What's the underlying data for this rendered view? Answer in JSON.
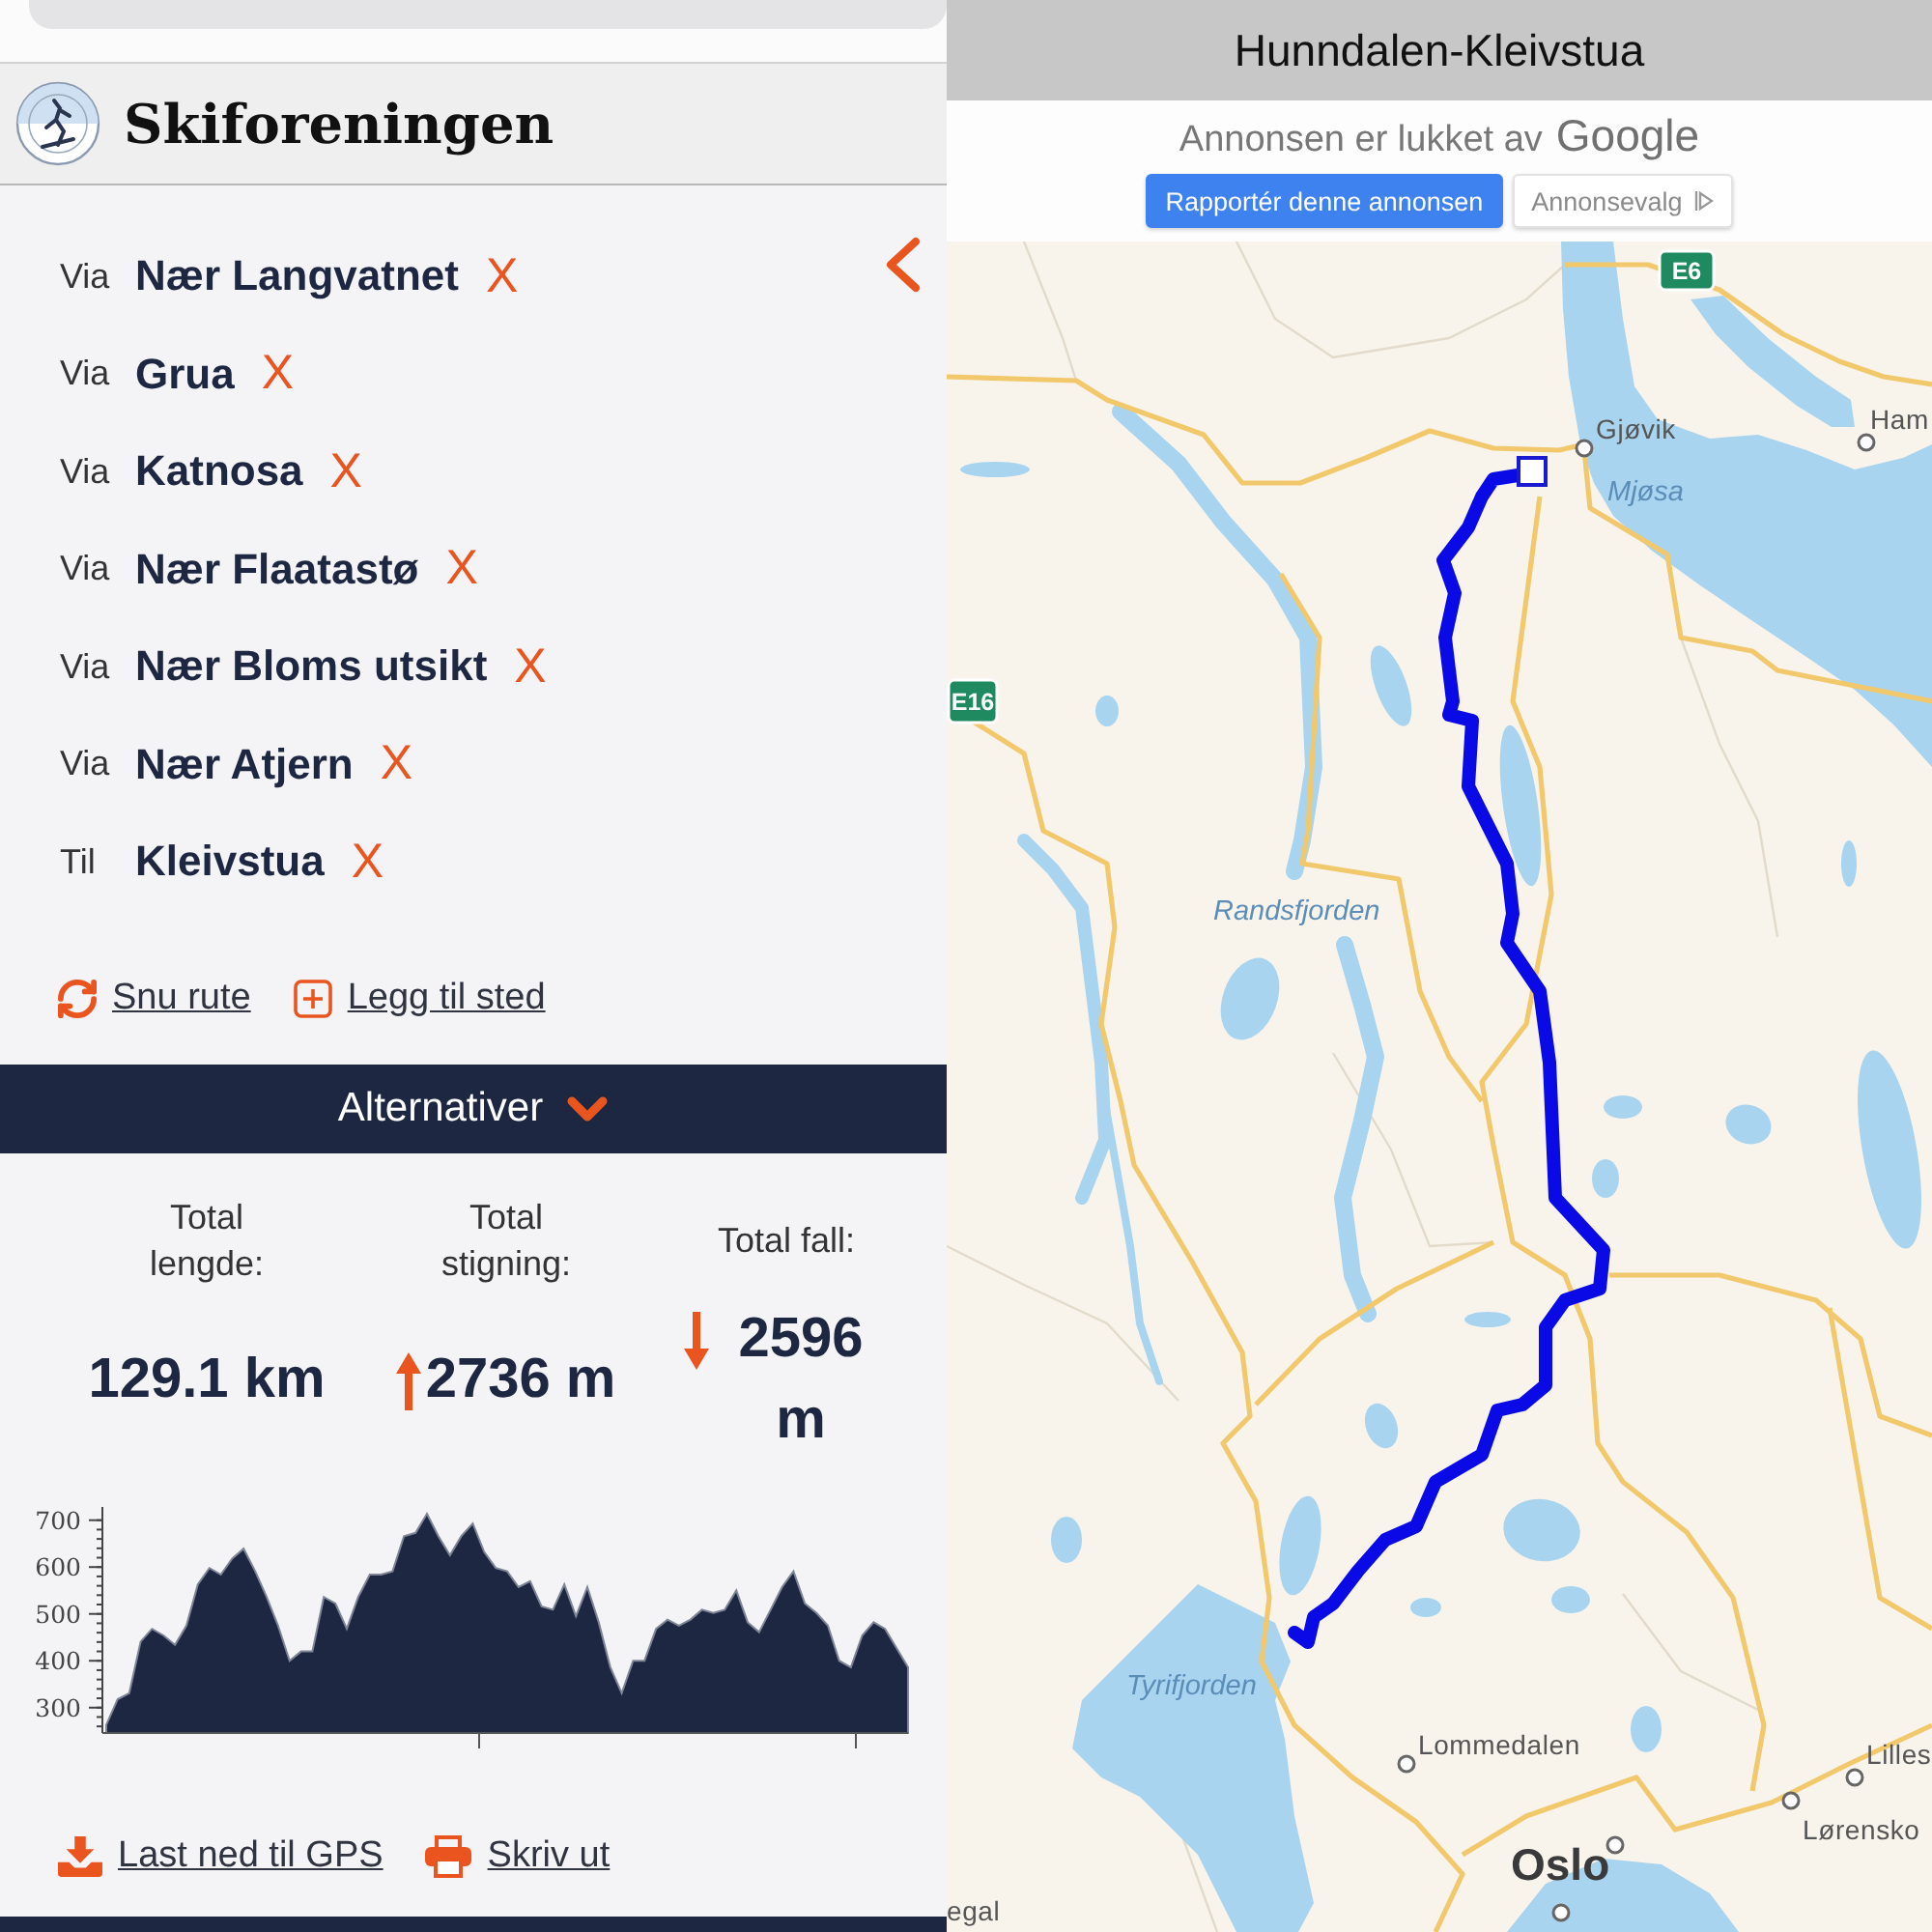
{
  "header": {
    "title": "Skiforeningen"
  },
  "route": {
    "stops": [
      {
        "prefix": "Via",
        "name": "Nær Langvatnet",
        "remove": "X"
      },
      {
        "prefix": "Via",
        "name": "Grua",
        "remove": "X"
      },
      {
        "prefix": "Via",
        "name": "Katnosa",
        "remove": "X"
      },
      {
        "prefix": "Via",
        "name": "Nær Flaatastø",
        "remove": "X"
      },
      {
        "prefix": "Via",
        "name": "Nær Bloms utsikt",
        "remove": "X"
      },
      {
        "prefix": "Via",
        "name": "Nær Atjern",
        "remove": "X"
      },
      {
        "prefix": "Til",
        "name": "Kleivstua",
        "remove": "X"
      }
    ]
  },
  "route_actions": [
    {
      "kind": "reverse",
      "label": "Snu rute"
    },
    {
      "kind": "add",
      "label": "Legg til sted"
    }
  ],
  "options_bar": {
    "label": "Alternativer",
    "expanded": false
  },
  "stats": [
    {
      "kind": "distance",
      "label": "Total lengde:",
      "value": "129.1 km"
    },
    {
      "kind": "ascent",
      "label": "Total stigning:",
      "value": "2736 m"
    },
    {
      "kind": "descent",
      "label": "Total fall:",
      "value": "2596 m"
    }
  ],
  "elevation_profile": {
    "chart_data": {
      "type": "area",
      "ylim": [
        250,
        720
      ],
      "yticks": [
        300,
        400,
        500,
        600,
        700
      ],
      "values": [
        263,
        318,
        331,
        441,
        468,
        454,
        434,
        475,
        563,
        598,
        584,
        618,
        639,
        591,
        536,
        475,
        400,
        420,
        420,
        536,
        522,
        468,
        536,
        584,
        584,
        591,
        666,
        673,
        714,
        666,
        625,
        666,
        693,
        632,
        598,
        591,
        557,
        570,
        516,
        509,
        563,
        495,
        557,
        482,
        386,
        331,
        400,
        400,
        468,
        488,
        475,
        488,
        509,
        502,
        509,
        550,
        482,
        461,
        509,
        557,
        591,
        522,
        502,
        475,
        400,
        386,
        454,
        482,
        468,
        427,
        386
      ]
    }
  },
  "downloads": [
    {
      "kind": "gps",
      "label": "Last ned til GPS"
    },
    {
      "kind": "print",
      "label": "Skriv ut"
    }
  ],
  "map_panel": {
    "title": "Hunndalen-Kleivstua",
    "ad_notice": {
      "text": "Annonsen er lukket av",
      "brand": "Google",
      "buttons": [
        {
          "kind": "primary",
          "label": "Rapportér denne annonsen"
        },
        {
          "kind": "secondary",
          "label": "Annonsevalg"
        }
      ]
    },
    "map": {
      "road_shields": [
        "E6",
        "E16"
      ],
      "labels": [
        {
          "kind": "town",
          "text": "Gjøvik"
        },
        {
          "kind": "water",
          "text": "Mjøsa"
        },
        {
          "kind": "town",
          "text": "Ham"
        },
        {
          "kind": "water",
          "text": "Randsfjorden"
        },
        {
          "kind": "water",
          "text": "Tyrifjorden"
        },
        {
          "kind": "town",
          "text": "Lommedalen"
        },
        {
          "kind": "capital",
          "text": "Oslo"
        },
        {
          "kind": "town",
          "text": "Lilles"
        },
        {
          "kind": "town",
          "text": "Lørensko"
        },
        {
          "kind": "town",
          "text": "egal"
        }
      ]
    }
  }
}
